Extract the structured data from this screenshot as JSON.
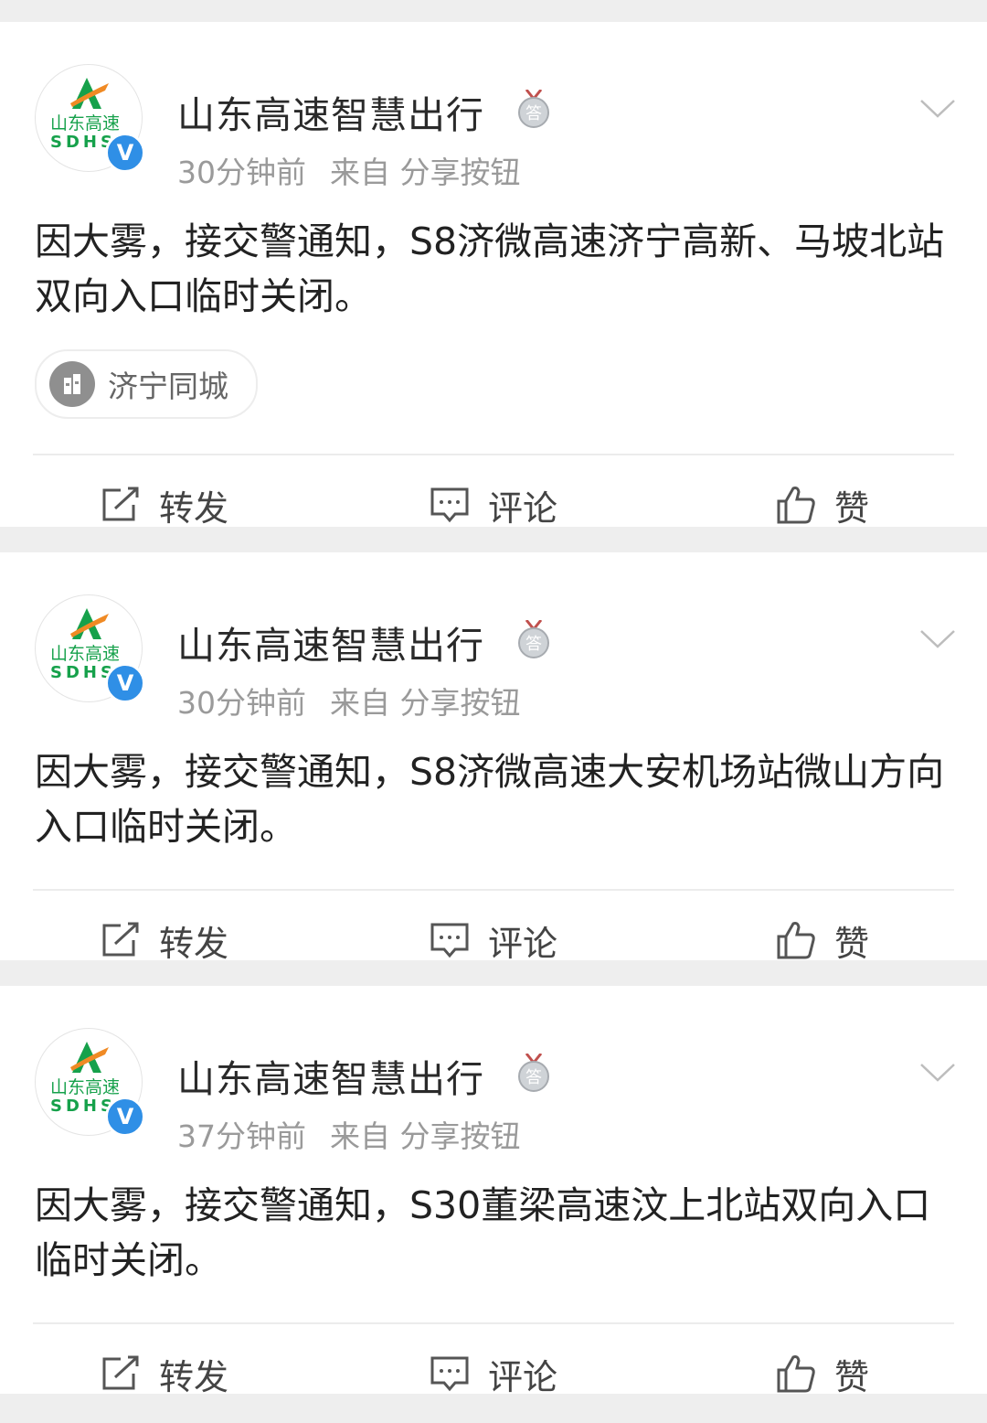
{
  "account": {
    "name": "山东高速智慧出行",
    "logo_text_cn": "山东高速",
    "logo_text_en": "SDHS",
    "verified_mark": "V",
    "medal_char": "答"
  },
  "colors": {
    "logo_green": "#16a14b",
    "logo_orange": "#f08a24",
    "verified_blue": "#2f8fe6"
  },
  "icons": [
    "chevron-down-icon",
    "medal-icon",
    "verified-icon",
    "location-icon",
    "repost-icon",
    "comment-icon",
    "like-icon"
  ],
  "posts": [
    {
      "time": "30分钟前",
      "source": "来自 分享按钮",
      "text": "因大雾，接交警通知，S8济微高速济宁高新、马坡北站双向入口临时关闭。",
      "tag": "济宁同城",
      "actions": {
        "repost": "转发",
        "comment": "评论",
        "like": "赞"
      }
    },
    {
      "time": "30分钟前",
      "source": "来自 分享按钮",
      "text": "因大雾，接交警通知，S8济微高速大安机场站微山方向入口临时关闭。",
      "actions": {
        "repost": "转发",
        "comment": "评论",
        "like": "赞"
      }
    },
    {
      "time": "37分钟前",
      "source": "来自 分享按钮",
      "text": "因大雾，接交警通知，S30董梁高速汶上北站双向入口临时关闭。",
      "actions": {
        "repost": "转发",
        "comment": "评论",
        "like": "赞"
      }
    }
  ]
}
